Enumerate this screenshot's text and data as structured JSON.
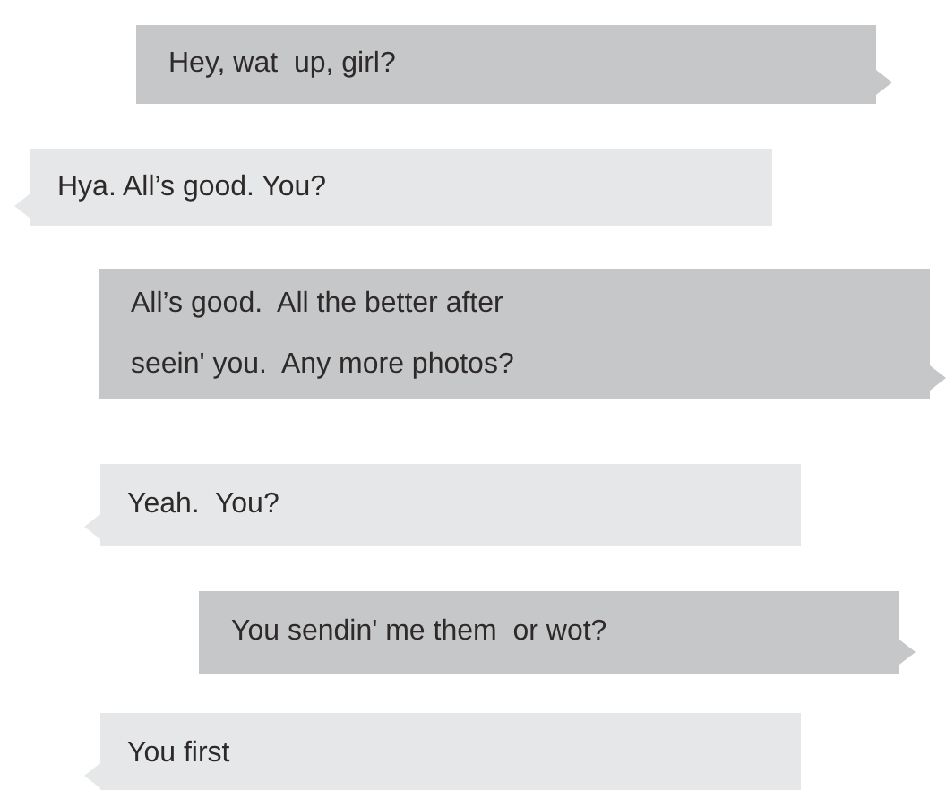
{
  "messages": [
    {
      "kind": "sent",
      "text": "Hey, wat  up, girl?"
    },
    {
      "kind": "received",
      "text": "Hya. All’s good. You?"
    },
    {
      "kind": "sent",
      "text": "All’s good.  All the better after\nseein' you.  Any more photos?"
    },
    {
      "kind": "received",
      "text": "Yeah.  You?"
    },
    {
      "kind": "sent",
      "text": "You sendin' me them  or wot?"
    },
    {
      "kind": "received",
      "text": "You first"
    }
  ]
}
